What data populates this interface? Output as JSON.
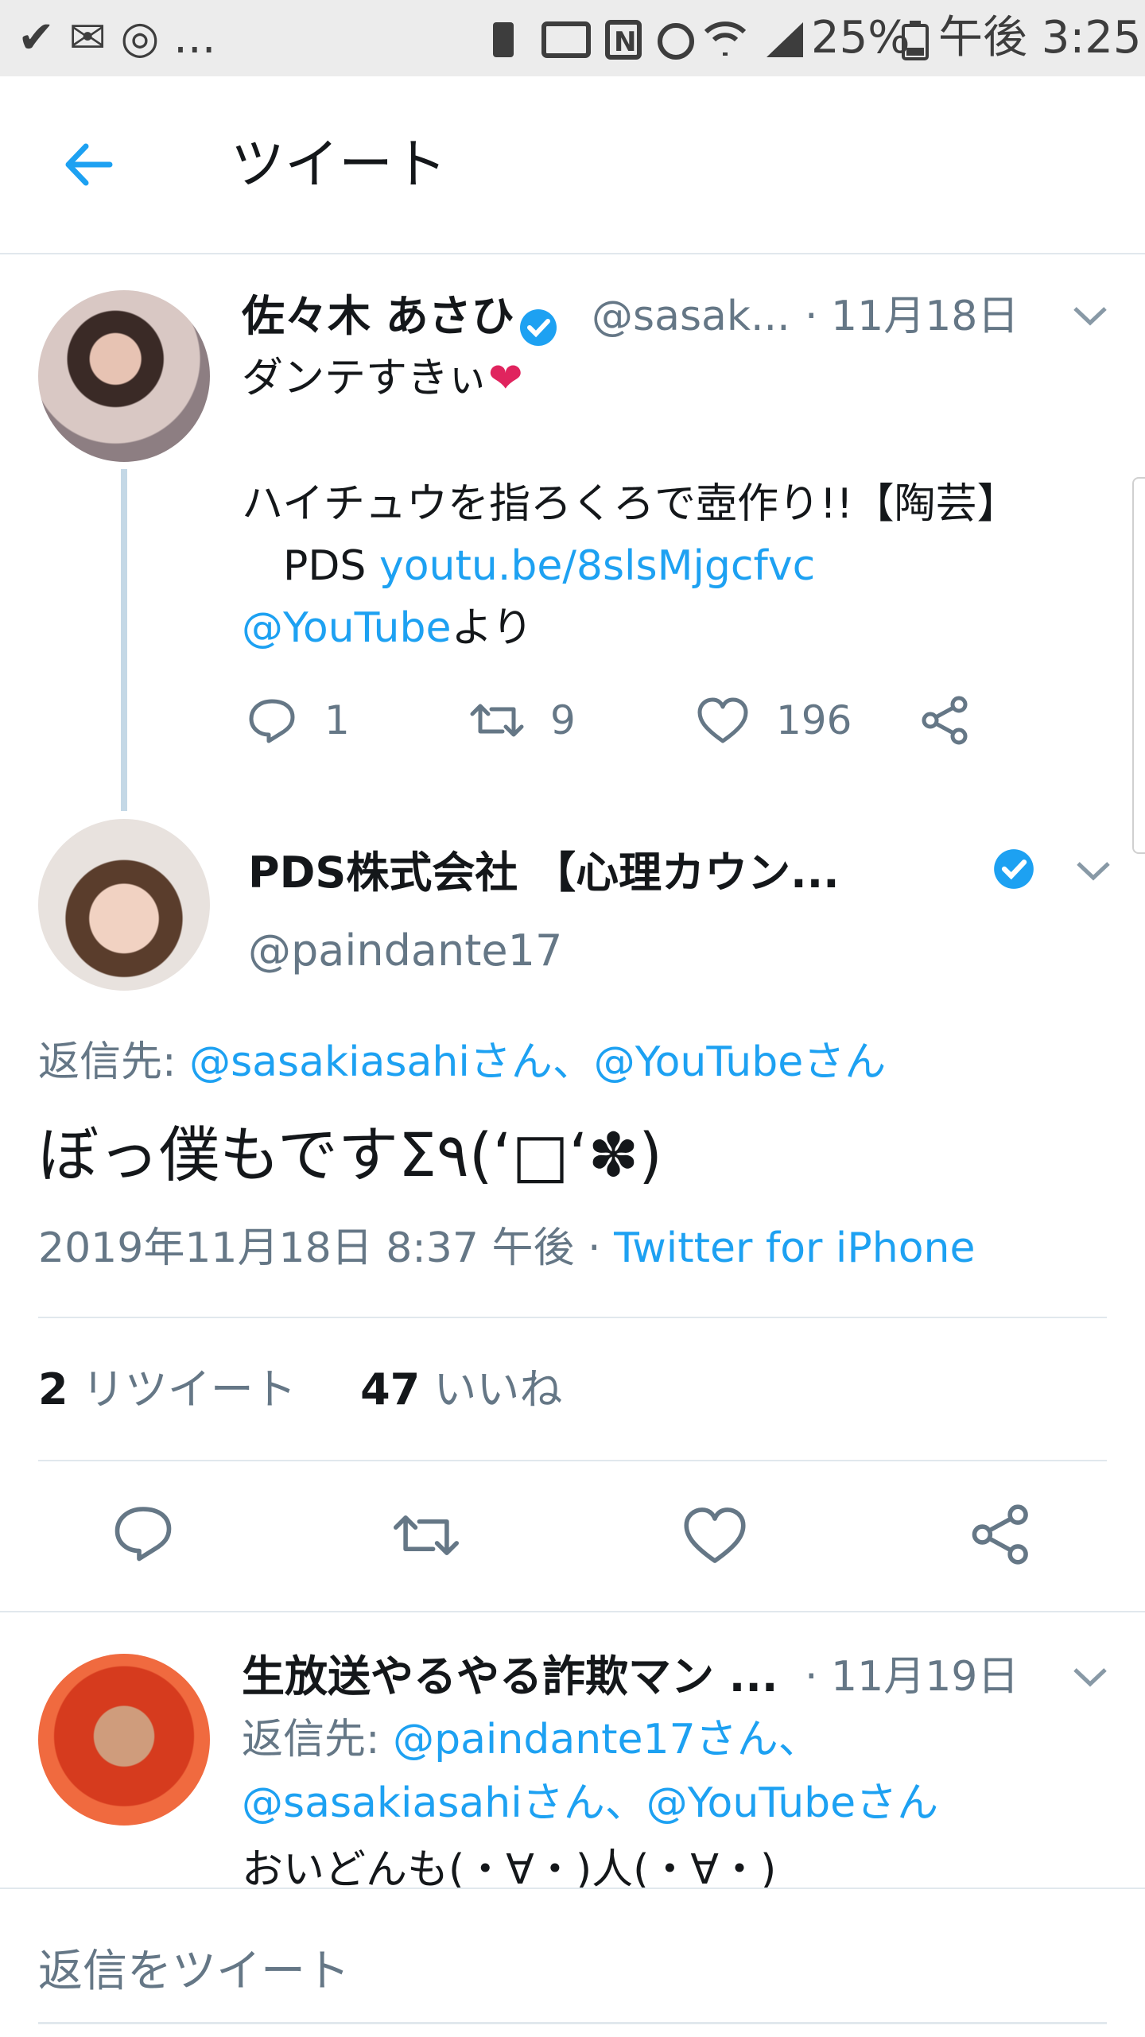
{
  "status_bar": {
    "notifications": "✔ ✉ ◎ ...",
    "battery": "25%",
    "time": "午後 3:25"
  },
  "header": {
    "title": "ツイート"
  },
  "parent_tweet": {
    "display_name": "佐々木 あさひ",
    "handle": "@sasak...",
    "date": "· 11月18日",
    "line1": "ダンテすきぃ",
    "heart_emoji": "❤",
    "line2": "ハイチュウを指ろくろで壺作り!!【陶芸】",
    "line3_prefix": "　PDS ",
    "line3_link": "youtu.be/8slsMjgcfvc",
    "line4_link": "@YouTube",
    "line4_suffix": "より",
    "reply_count": "1",
    "retweet_count": "9",
    "like_count": "196"
  },
  "main_tweet": {
    "display_name": "PDS株式会社 【心理カウン...",
    "handle": "@paindante17",
    "reply_to_label": "返信先: ",
    "reply_to_users": "@sasakiasahiさん、@YouTubeさん",
    "text": "ぼっ僕もですΣ٩(ʻ□ʻ✽)",
    "timestamp": "2019年11月18日 8:37 午後 · ",
    "source": "Twitter for iPhone",
    "retweets_count": "2",
    "retweets_label": "リツイート",
    "likes_count": "47",
    "likes_label": "いいね"
  },
  "reply_tweet": {
    "display_name": "生放送やるやる詐欺マン ...",
    "date": "· 11月19日",
    "reply_to_label": "返信先: ",
    "reply_to_line1": "@paindante17さん、",
    "reply_to_line2": "@sasakiasahiさん、@YouTubeさん",
    "text_partial": "おいどんも(・∀・)人(・∀・)"
  },
  "composer": {
    "placeholder": "返信をツイート"
  },
  "colors": {
    "accent": "#1da1f2",
    "secondary_text": "#657786",
    "heart": "#e0245e"
  }
}
